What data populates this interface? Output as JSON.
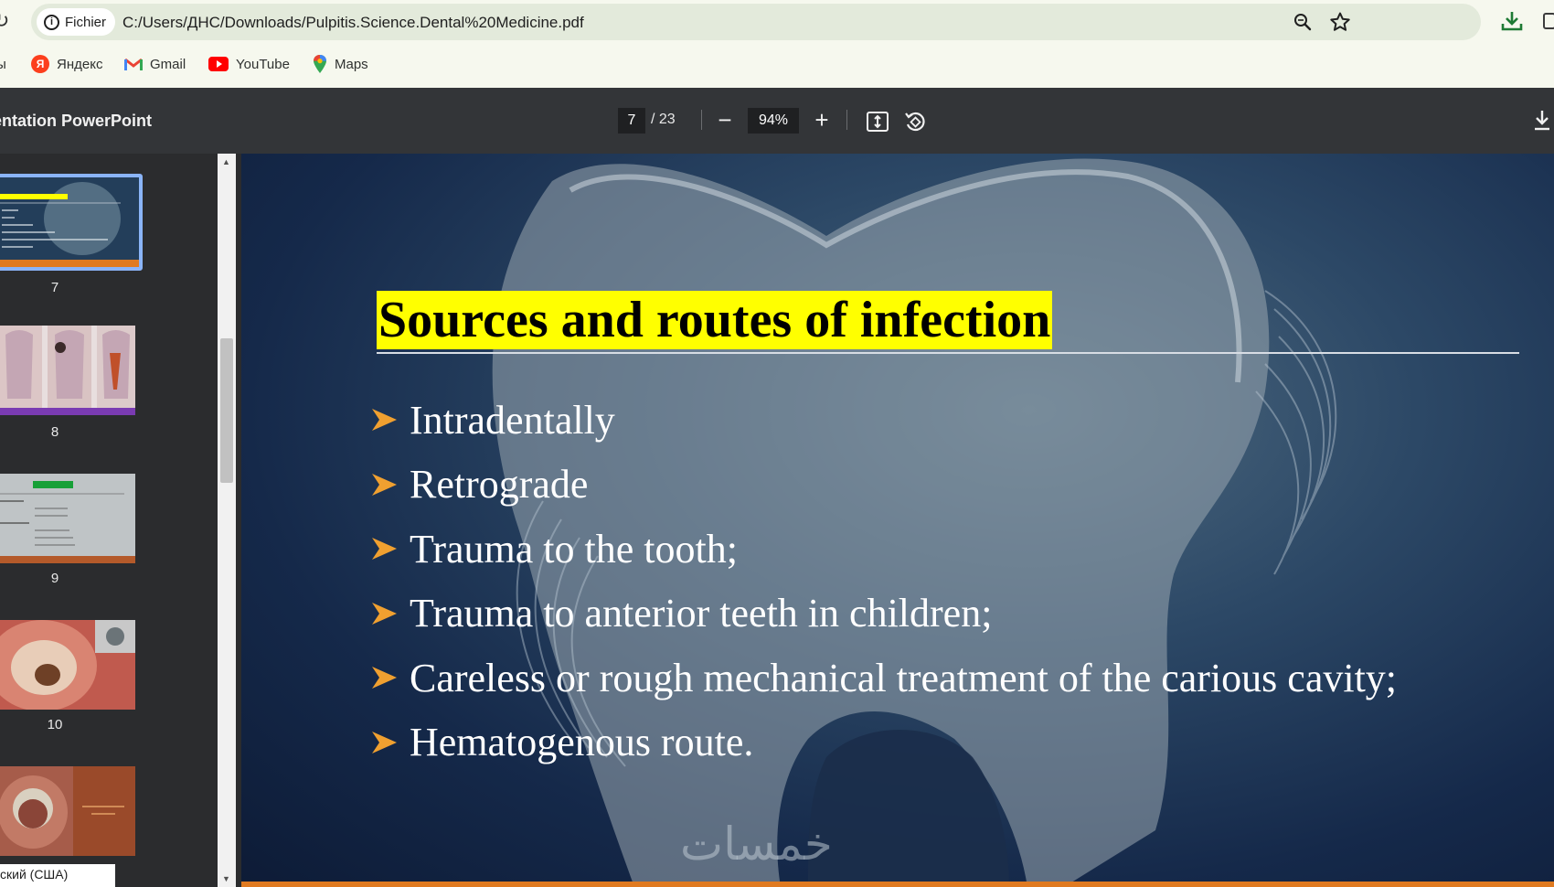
{
  "browser": {
    "site_chip_label": "Fichier",
    "url": "C:/Users/ДНС/Downloads/Pulpitis.Science.Dental%20Medicine.pdf",
    "bookmarks": [
      {
        "label": "ы"
      },
      {
        "label": "Яндекс"
      },
      {
        "label": "Gmail"
      },
      {
        "label": "YouTube"
      },
      {
        "label": "Maps"
      }
    ]
  },
  "pdf_viewer": {
    "doc_title": "entation PowerPoint",
    "current_page": "7",
    "total_pages": "/ 23",
    "zoom": "94%",
    "thumbnails": [
      {
        "page": "7",
        "selected": true,
        "caption": "rces and routes of infection"
      },
      {
        "page": "8",
        "selected": false
      },
      {
        "page": "9",
        "selected": false,
        "caption": "Classification"
      },
      {
        "page": "10",
        "selected": false
      },
      {
        "page": "",
        "selected": false,
        "caption": "Chronic fibrous pulpitis"
      }
    ]
  },
  "slide": {
    "title": "Sources and routes of infection",
    "bullets": [
      "Intradentally",
      "Retrograde",
      "Trauma to the tooth;",
      "Trauma to anterior teeth in children;",
      "Careless or rough mechanical treatment of the carious cavity;",
      "Hematogenous route."
    ],
    "watermark": "خمسات"
  },
  "taskbar": {
    "ime_label": "ский (США)"
  },
  "colors": {
    "title_highlight": "#ffff00",
    "bullet_arrow": "#f0a030",
    "accent_bar": "#e07a20",
    "thumb_selected": "#8ab4f8"
  },
  "icons": {
    "reload": "reload-icon",
    "info": "info-icon",
    "zoom": "search-icon",
    "bookmark": "star-icon",
    "download": "download-icon",
    "fit": "fit-page-icon",
    "rotate": "rotate-icon"
  }
}
